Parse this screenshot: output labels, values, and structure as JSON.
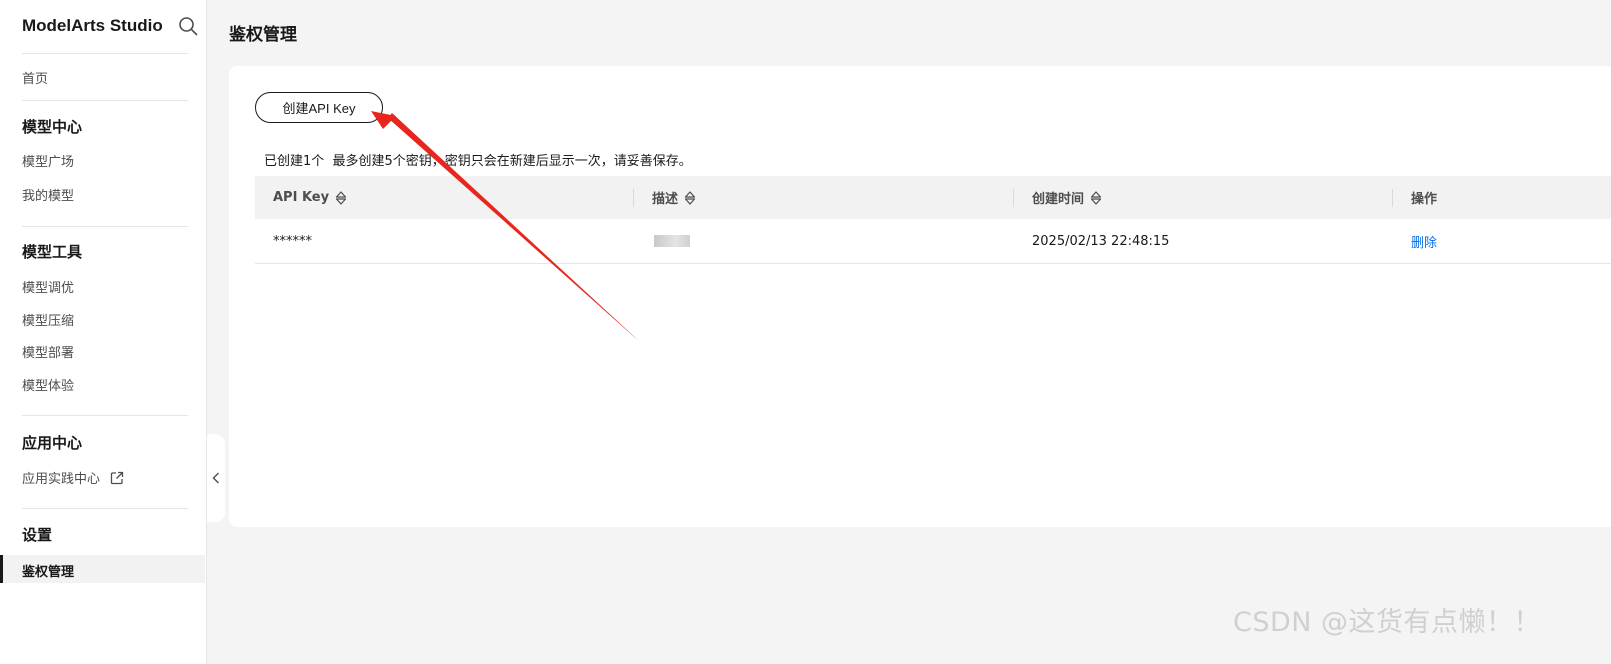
{
  "sidebar": {
    "brand": "ModelArts Studio",
    "home": "首页",
    "groups": [
      {
        "title": "模型中心",
        "items": [
          "模型广场",
          "我的模型"
        ]
      },
      {
        "title": "模型工具",
        "items": [
          "模型调优",
          "模型压缩",
          "模型部署",
          "模型体验"
        ]
      },
      {
        "title": "应用中心",
        "items": [
          "应用实践中心"
        ]
      },
      {
        "title": "设置",
        "items": [
          "鉴权管理"
        ]
      }
    ],
    "active_item": "鉴权管理"
  },
  "page": {
    "title": "鉴权管理"
  },
  "toolbar": {
    "create_label": "创建API Key",
    "hint": "已创建1个  最多创建5个密钥，密钥只会在新建后显示一次，请妥善保存。"
  },
  "table": {
    "columns": [
      "API Key",
      "描述",
      "创建时间",
      "操作"
    ],
    "rows": [
      {
        "api_key": "******",
        "created": "2025/02/13 22:48:15",
        "action": "删除"
      }
    ]
  },
  "watermark": "CSDN @这货有点懒！！",
  "colors": {
    "accent_link": "#0a6ee6",
    "annotation_arrow": "#e8261e",
    "active_bar": "#191919"
  },
  "icons": [
    "search-icon",
    "external-link-icon",
    "chevron-left-icon",
    "sort-icon",
    "annotation-arrow"
  ]
}
